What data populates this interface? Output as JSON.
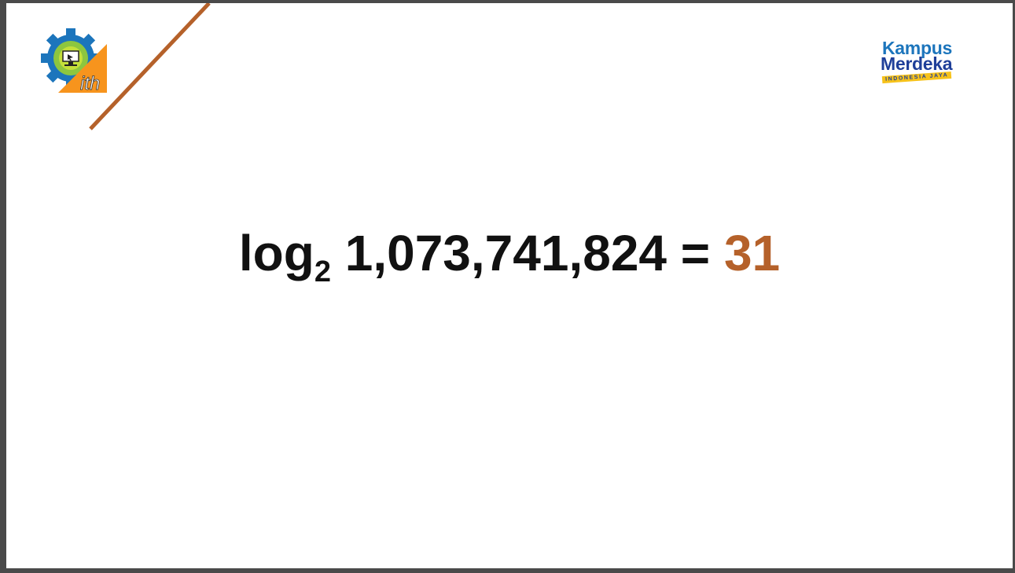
{
  "logos": {
    "left": {
      "name": "ith-logo",
      "text": "ith"
    },
    "right": {
      "line1": "Kampus",
      "line2": "Merdeka",
      "tagline": "INDONESIA JAYA"
    }
  },
  "equation": {
    "function": "log",
    "base": "2",
    "argument": "1,073,741,824",
    "operator": "=",
    "result": "31"
  },
  "colors": {
    "accent": "#b5612a",
    "text": "#111111",
    "km_blue": "#1c75bc",
    "km_navy": "#1f3f99",
    "km_yellow": "#f6c21a"
  }
}
